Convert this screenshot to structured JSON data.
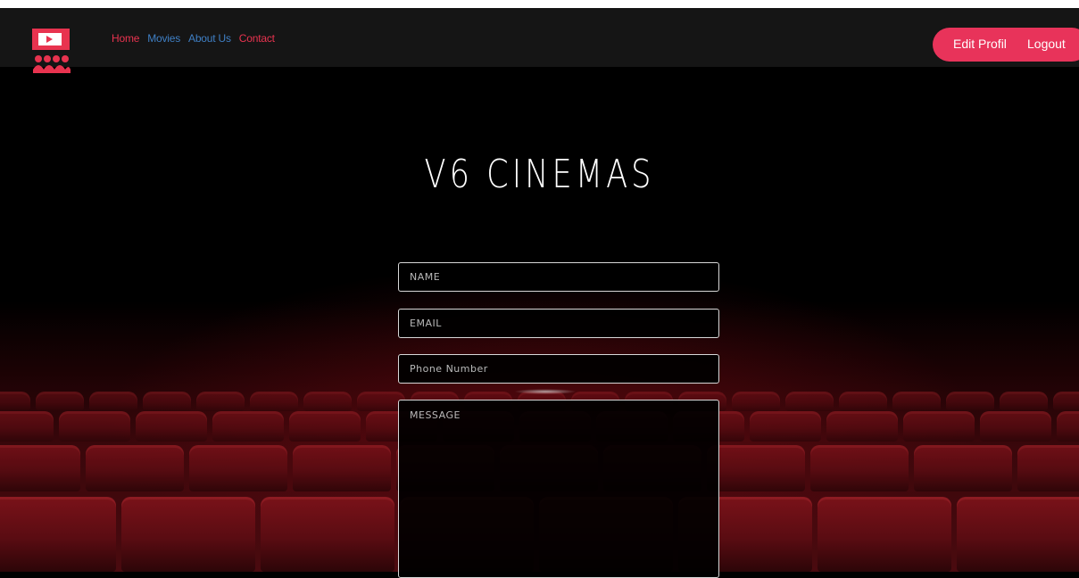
{
  "nav": {
    "links": [
      "Home",
      "Movies",
      "About Us",
      "Contact"
    ],
    "edit_profile": "Edit Profil",
    "logout": "Logout"
  },
  "hero": {
    "title": "V6 CINEMAS"
  },
  "form": {
    "name_placeholder": "NAME",
    "email_placeholder": "EMAIL",
    "phone_placeholder": "Phone Number",
    "message_placeholder": "MESSAGE"
  },
  "colors": {
    "accent": "#e8335a",
    "link_blue": "#3f7fc4",
    "seat_red": "#7a1219"
  },
  "icons": {
    "logo": "cinema-logo-icon"
  }
}
